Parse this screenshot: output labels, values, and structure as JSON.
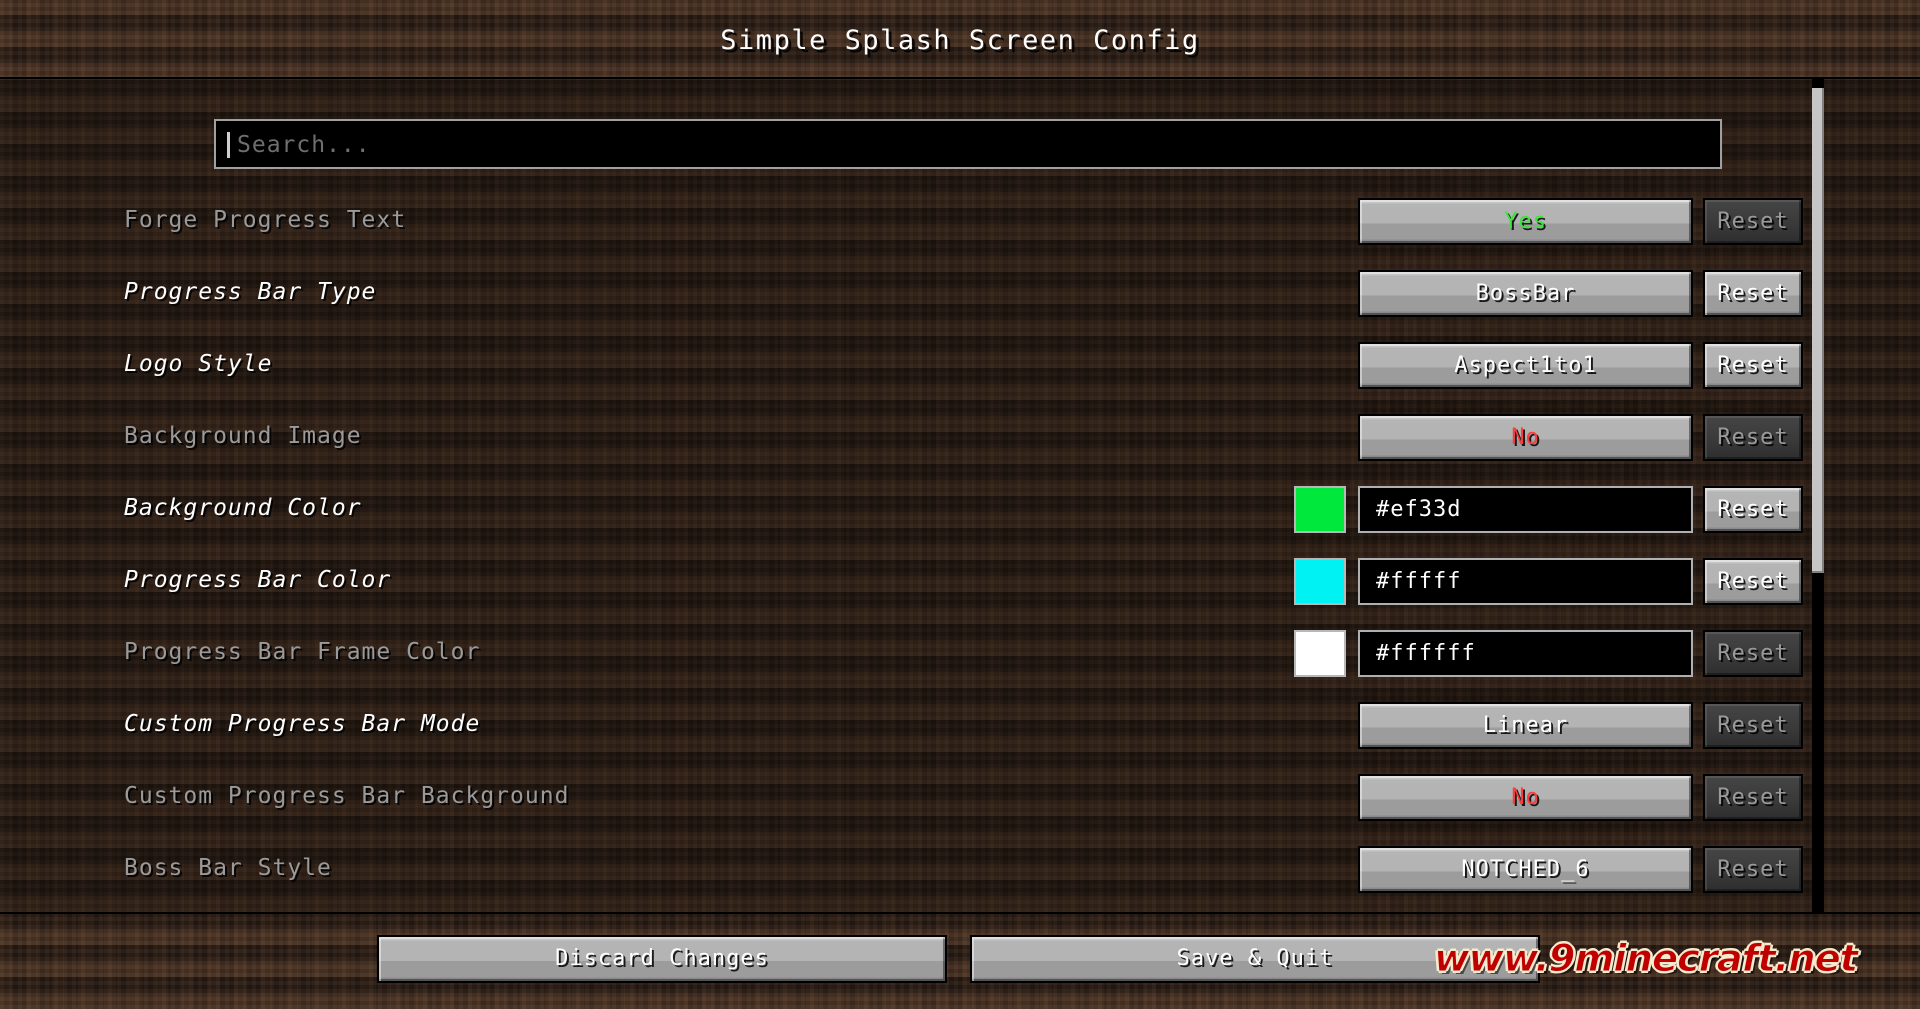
{
  "header": {
    "title": "Simple Splash Screen Config"
  },
  "search": {
    "value": "",
    "placeholder": "Search..."
  },
  "reset_label": "Reset",
  "rows": [
    {
      "label": "Forge Progress Text",
      "modified": false,
      "widget": "button",
      "value": "Yes",
      "value_color": "green",
      "reset_enabled": false
    },
    {
      "label": "Progress Bar Type",
      "modified": true,
      "widget": "button",
      "value": "BossBar",
      "value_color": "white",
      "reset_enabled": true
    },
    {
      "label": "Logo Style",
      "modified": true,
      "widget": "button",
      "value": "Aspect1to1",
      "value_color": "white",
      "reset_enabled": true
    },
    {
      "label": "Background Image",
      "modified": false,
      "widget": "button",
      "value": "No",
      "value_color": "red",
      "reset_enabled": false
    },
    {
      "label": "Background Color",
      "modified": true,
      "widget": "color",
      "value": "#ef33d",
      "swatch": "#00e83c",
      "reset_enabled": true
    },
    {
      "label": "Progress Bar Color",
      "modified": true,
      "widget": "color",
      "value": "#fffff",
      "swatch": "#00f2f2",
      "reset_enabled": true
    },
    {
      "label": "Progress Bar Frame Color",
      "modified": false,
      "widget": "color",
      "value": "#ffffff",
      "swatch": "#ffffff",
      "reset_enabled": false
    },
    {
      "label": "Custom Progress Bar Mode",
      "modified": true,
      "widget": "button",
      "value": "Linear",
      "value_color": "white",
      "reset_enabled": false
    },
    {
      "label": "Custom Progress Bar Background",
      "modified": false,
      "widget": "button",
      "value": "No",
      "value_color": "red",
      "reset_enabled": false
    },
    {
      "label": "Boss Bar Style",
      "modified": false,
      "widget": "button",
      "value": "NOTCHED_6",
      "value_color": "white",
      "reset_enabled": false
    }
  ],
  "footer": {
    "discard_label": "Discard Changes",
    "save_label": "Save & Quit",
    "watermark": "www.9minecraft.net"
  }
}
